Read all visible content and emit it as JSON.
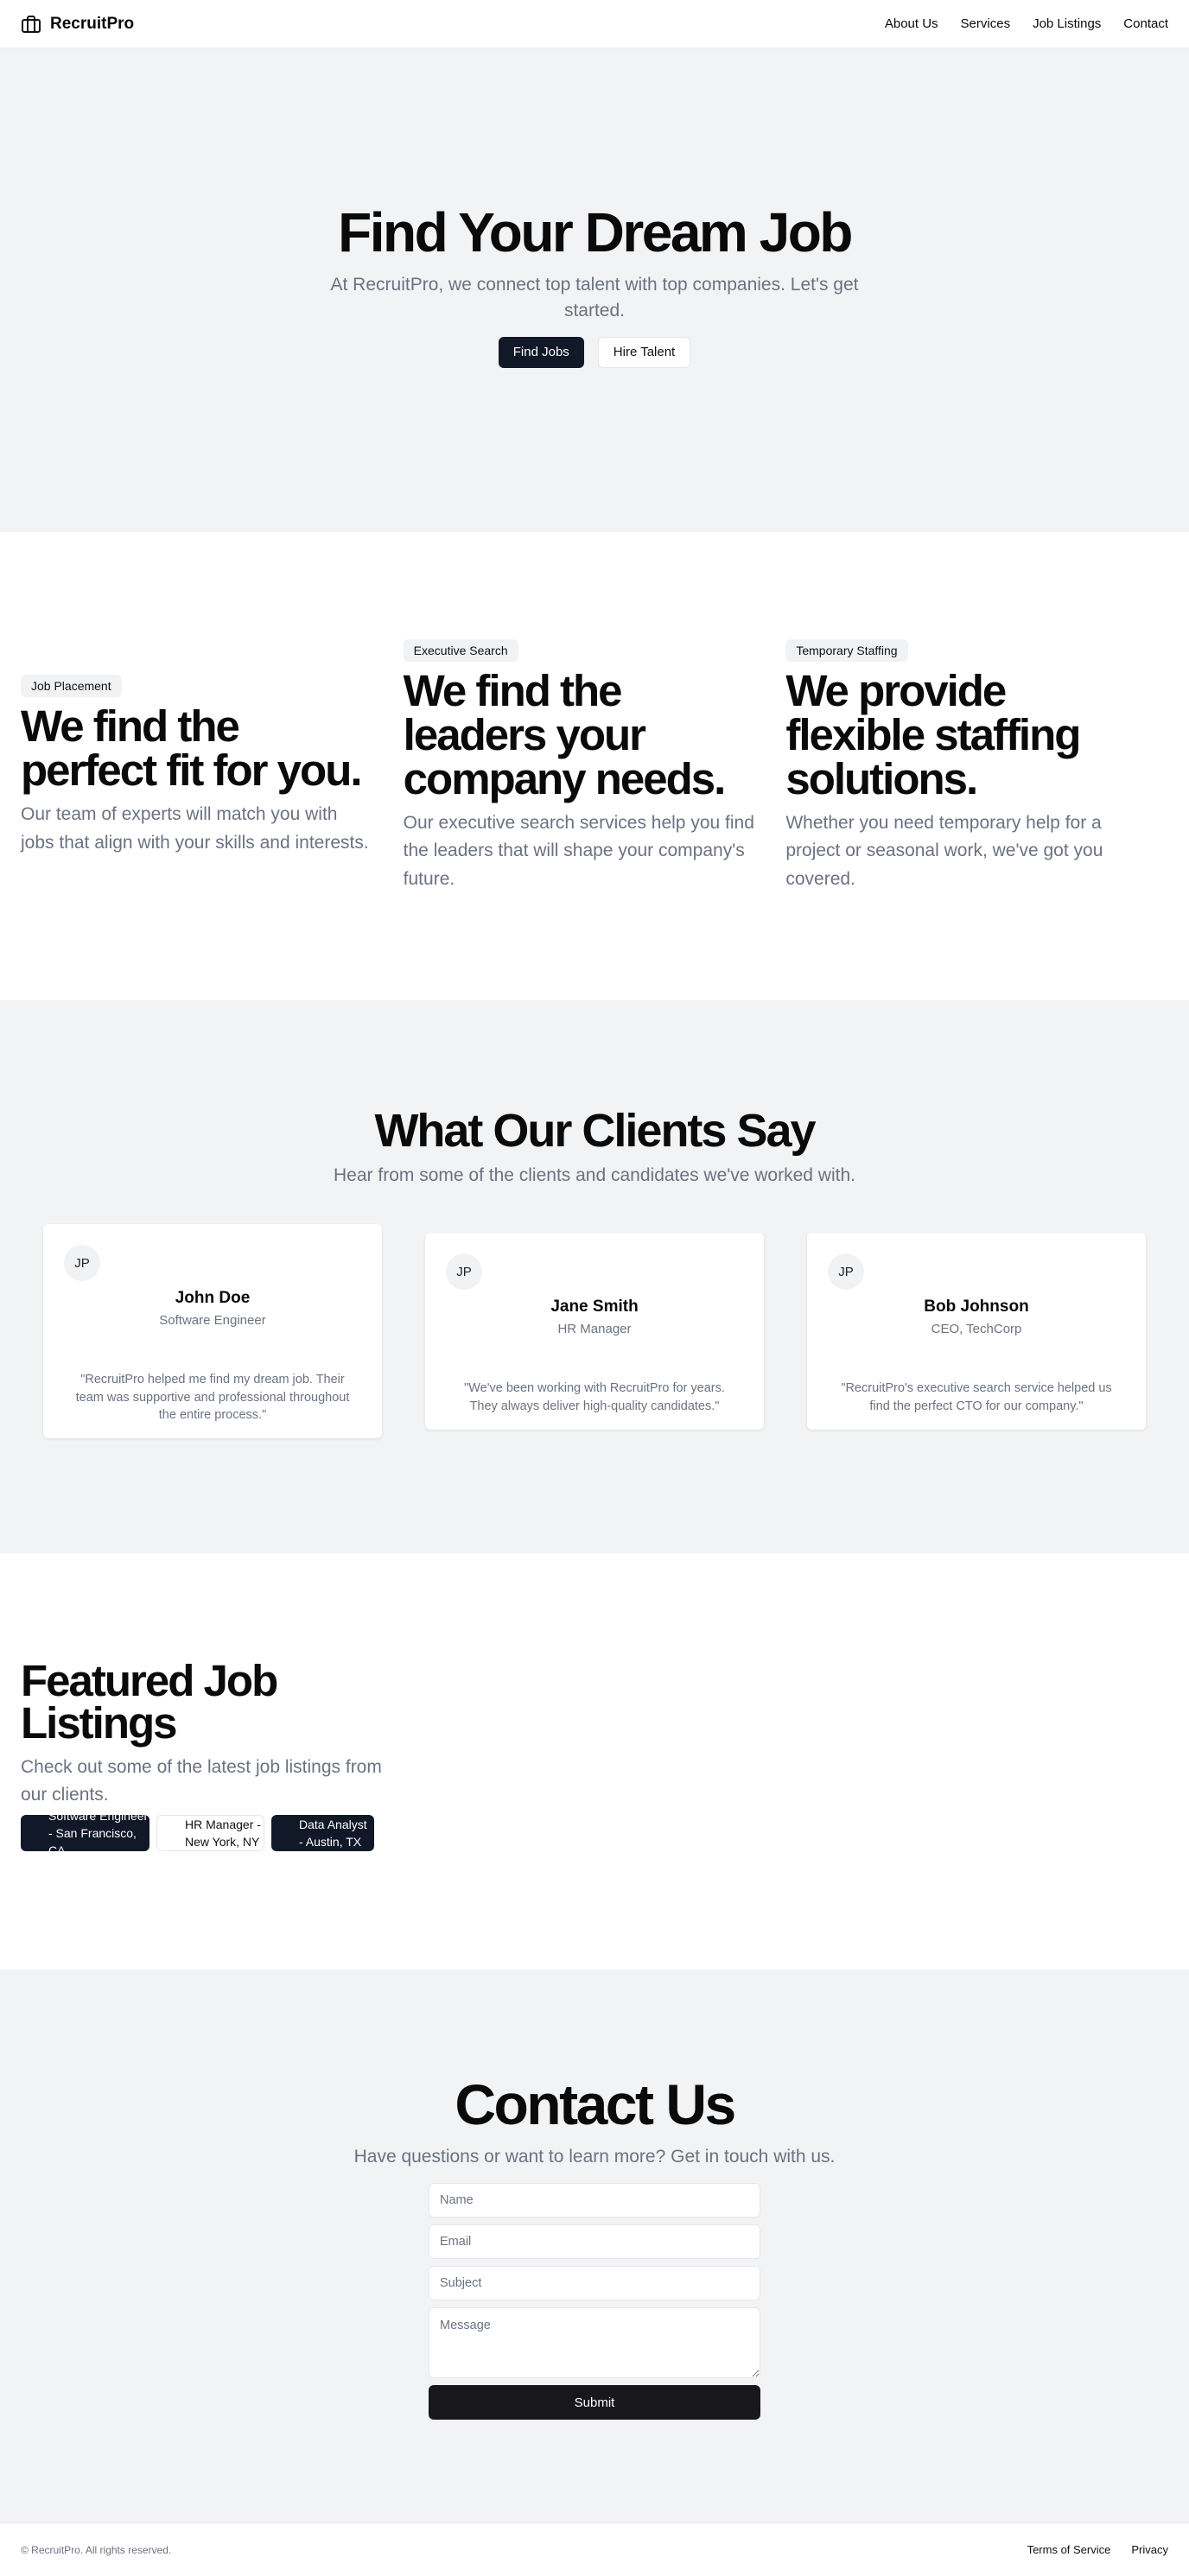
{
  "header": {
    "brand": "RecruitPro",
    "brand_icon": "briefcase-icon",
    "nav": [
      "About Us",
      "Services",
      "Job Listings",
      "Contact"
    ]
  },
  "hero": {
    "title": "Find Your Dream Job",
    "subtitle": "At RecruitPro, we connect top talent with top companies. Let's get started.",
    "primary_button": "Find Jobs",
    "secondary_button": "Hire Talent"
  },
  "services": [
    {
      "badge": "Job Placement",
      "title": "We find the perfect fit for you.",
      "text": "Our team of experts will match you with jobs that align with your skills and interests."
    },
    {
      "badge": "Executive Search",
      "title": "We find the leaders your company needs.",
      "text": "Our executive search services help you find the leaders that will shape your company's future."
    },
    {
      "badge": "Temporary Staffing",
      "title": "We provide flexible staffing solutions.",
      "text": "Whether you need temporary help for a project or seasonal work, we've got you covered."
    }
  ],
  "testimonials": {
    "title": "What Our Clients Say",
    "subtitle": "Hear from some of the clients and candidates we've worked with.",
    "items": [
      {
        "initials": "JP",
        "name": "John Doe",
        "role": "Software Engineer",
        "quote": "\"RecruitPro helped me find my dream job. Their team was supportive and professional throughout the entire process.\""
      },
      {
        "initials": "JP",
        "name": "Jane Smith",
        "role": "HR Manager",
        "quote": "\"We've been working with RecruitPro for years. They always deliver high-quality candidates.\""
      },
      {
        "initials": "JP",
        "name": "Bob Johnson",
        "role": "CEO, TechCorp",
        "quote": "\"RecruitPro's executive search service helped us find the perfect CTO for our company.\""
      }
    ]
  },
  "jobs": {
    "title": "Featured Job Listings",
    "subtitle": "Check out some of the latest job listings from our clients.",
    "listings": [
      "Software Engineer - San Francisco, CA",
      "HR Manager - New York, NY",
      "Data Analyst - Austin, TX"
    ]
  },
  "contact": {
    "title": "Contact Us",
    "subtitle": "Have questions or want to learn more? Get in touch with us.",
    "name_placeholder": "Name",
    "email_placeholder": "Email",
    "subject_placeholder": "Subject",
    "message_placeholder": "Message",
    "submit": "Submit"
  },
  "footer": {
    "copyright": "© RecruitPro. All rights reserved.",
    "links": [
      "Terms of Service",
      "Privacy"
    ]
  },
  "colors": {
    "primary_dark": "#111827",
    "muted_text": "#6b7280",
    "section_gray": "#f2f3f5"
  }
}
